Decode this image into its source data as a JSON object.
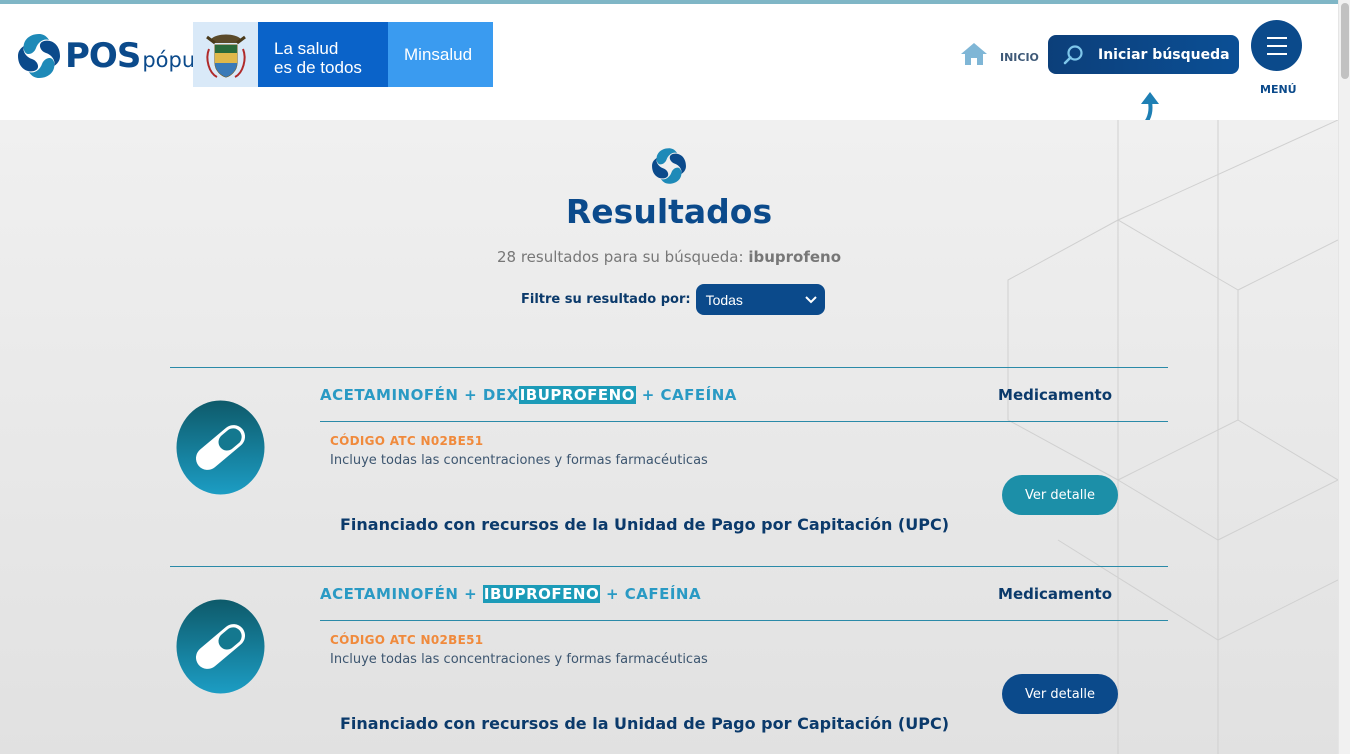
{
  "header": {
    "brand_main": "POS",
    "brand_sub": "pópuli",
    "gov_slogan_line1": "La salud",
    "gov_slogan_line2": "es de todos",
    "gov_ministry": "Minsalud",
    "home_label": "INICIO",
    "search_button": "Iniciar búsqueda",
    "menu_label": "MENÚ"
  },
  "main": {
    "title": "Resultados",
    "results_prefix": "28 resultados para su búsqueda: ",
    "query": "ibuprofeno",
    "filter_label": "Filtre su resultado por:",
    "filter_value": "Todas"
  },
  "results": [
    {
      "name_before": "ACETAMINOFÉN + DEX",
      "name_highlight": "IBUPROFENO",
      "name_after": " + CAFEÍNA",
      "type": "Medicamento",
      "code": "CÓDIGO ATC N02BE51",
      "description": "Incluye todas las concentraciones y formas farmacéuticas",
      "detail_button": "Ver detalle",
      "detail_color": "#1c8fa8",
      "funding": "Financiado con recursos de la Unidad de Pago por Capitación (UPC)"
    },
    {
      "name_before": "ACETAMINOFÉN + ",
      "name_highlight": "IBUPROFENO",
      "name_after": " + CAFEÍNA",
      "type": "Medicamento",
      "code": "CÓDIGO ATC N02BE51",
      "description": "Incluye todas las concentraciones y formas farmacéuticas",
      "detail_button": "Ver detalle",
      "detail_color": "#0b4a8b",
      "funding": "Financiado con recursos de la Unidad de Pago por Capitación (UPC)"
    }
  ],
  "colors": {
    "brand_dark": "#0b4a8b",
    "brand_teal": "#2a9ac4",
    "code_orange": "#f08a3c"
  }
}
